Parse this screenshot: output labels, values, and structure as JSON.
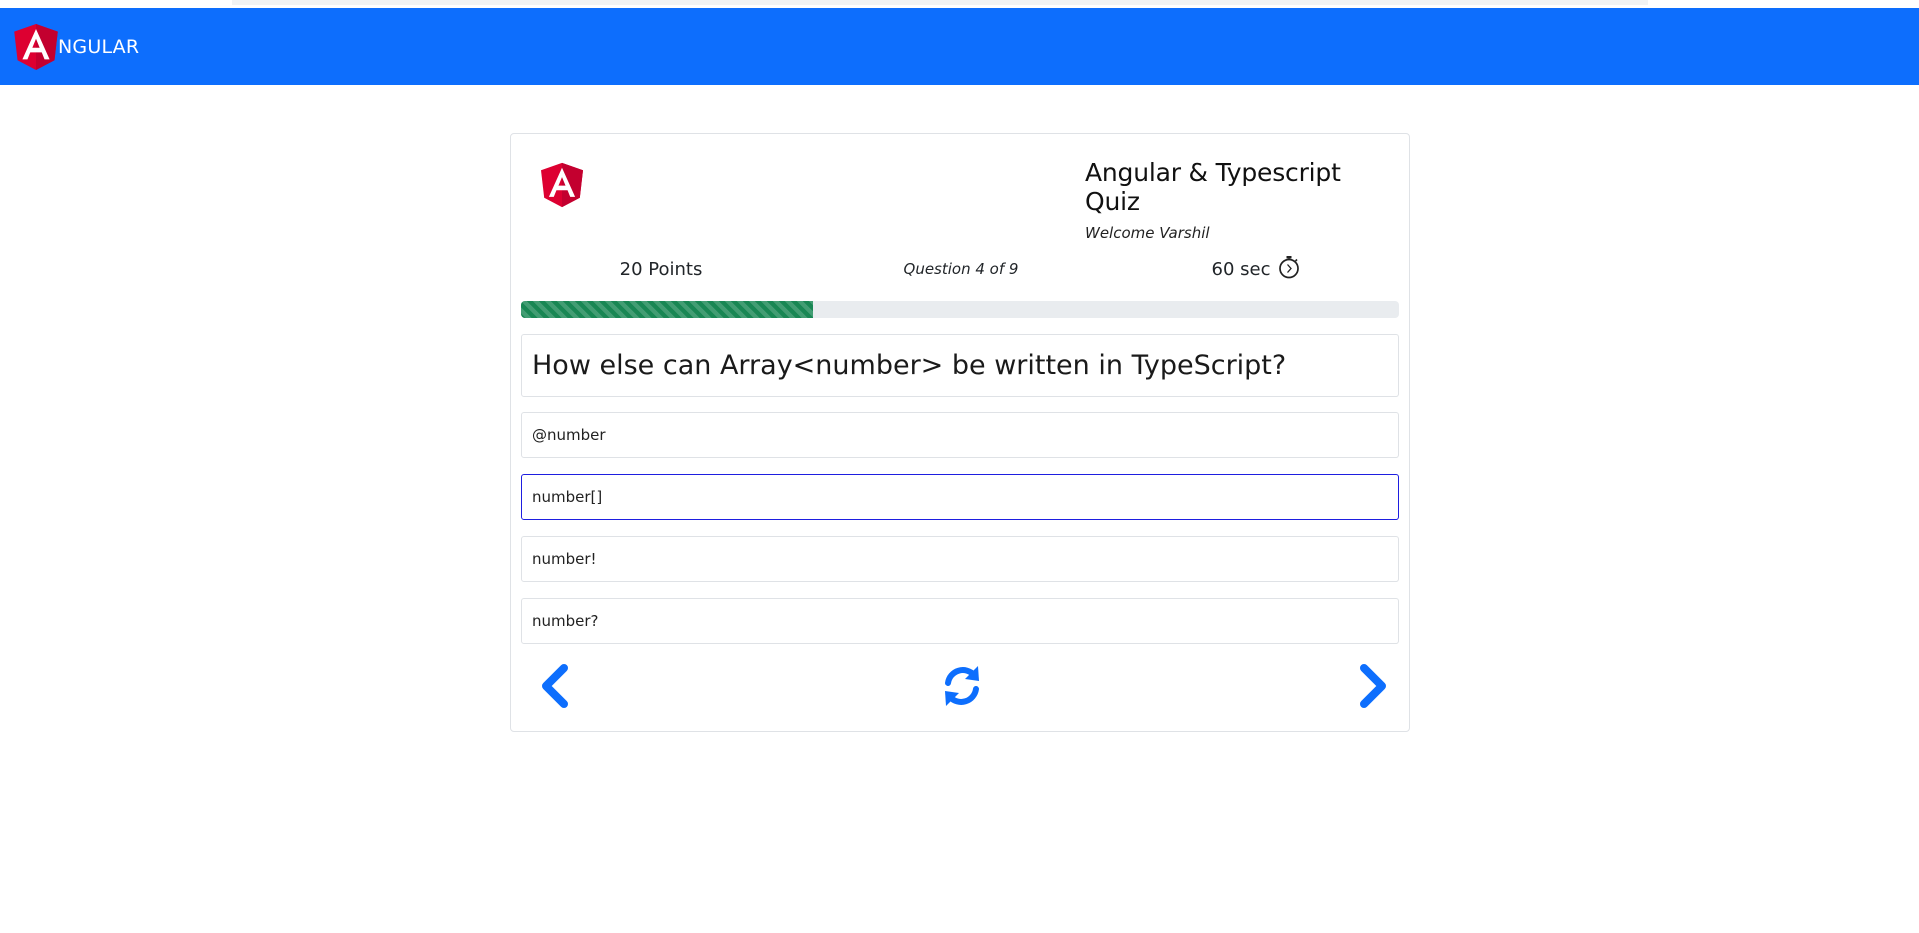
{
  "navbar": {
    "brand_text": "NGULAR",
    "brand_color": "#0d6efd"
  },
  "quiz": {
    "title": "Angular & Typescript Quiz",
    "welcome": "Welcome Varshil",
    "points": "20 Points",
    "question_counter": "Question 4 of 9",
    "timer": "60 sec",
    "progress_fraction": 0.333,
    "question": "How else can Array<number> be written in TypeScript?",
    "options": [
      {
        "label": "@number",
        "selected": false
      },
      {
        "label": "number[]",
        "selected": true
      },
      {
        "label": "number!",
        "selected": false
      },
      {
        "label": "number?",
        "selected": false
      }
    ]
  },
  "icons": {
    "logo": "angular-logo-icon",
    "timer": "stopwatch-icon",
    "prev": "chevron-left-icon",
    "reset": "refresh-icon",
    "next": "chevron-right-icon"
  },
  "colors": {
    "primary": "#0d6efd",
    "progress": "#198754",
    "selected_border": "#1e1ee0",
    "angular_red": "#dd0031"
  }
}
